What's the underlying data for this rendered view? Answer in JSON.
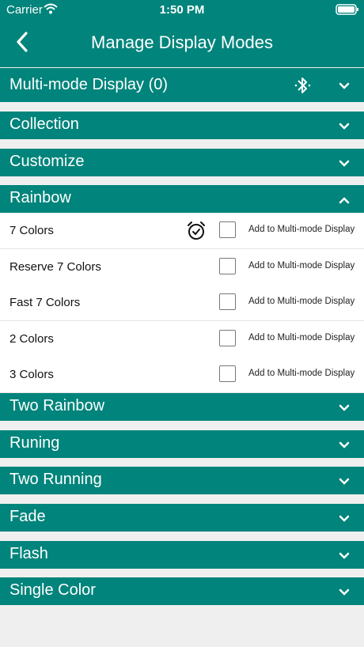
{
  "status_bar": {
    "carrier": "Carrier",
    "time": "1:50 PM"
  },
  "nav": {
    "title": "Manage Display Modes"
  },
  "multi_mode": {
    "label": "Multi-mode Display (0)"
  },
  "sections_top": [
    {
      "label": "Collection"
    },
    {
      "label": "Customize"
    },
    {
      "label": "Rainbow"
    }
  ],
  "rainbow_items": [
    {
      "name": "7 Colors",
      "add_label": "Add to Multi-mode Display",
      "has_alarm": true
    },
    {
      "name": "Reserve 7 Colors",
      "add_label": "Add to Multi-mode Display"
    },
    {
      "name": "Fast 7 Colors",
      "add_label": "Add to Multi-mode Display"
    },
    {
      "name": "2 Colors",
      "add_label": "Add to Multi-mode Display"
    },
    {
      "name": "3 Colors",
      "add_label": "Add to Multi-mode Display"
    }
  ],
  "sections_bottom": [
    {
      "label": "Two Rainbow"
    },
    {
      "label": "Runing"
    },
    {
      "label": "Two Running"
    },
    {
      "label": "Fade"
    },
    {
      "label": "Flash"
    },
    {
      "label": "Single Color"
    }
  ],
  "colors": {
    "teal": "#00847b",
    "background": "#efefef"
  },
  "icons": {
    "back": "chevron-left-icon",
    "bluetooth": "bluetooth-icon",
    "expand": "chevron-down-icon",
    "collapse": "chevron-up-icon",
    "alarm": "alarm-check-icon",
    "wifi": "wifi-icon",
    "battery": "battery-icon"
  }
}
